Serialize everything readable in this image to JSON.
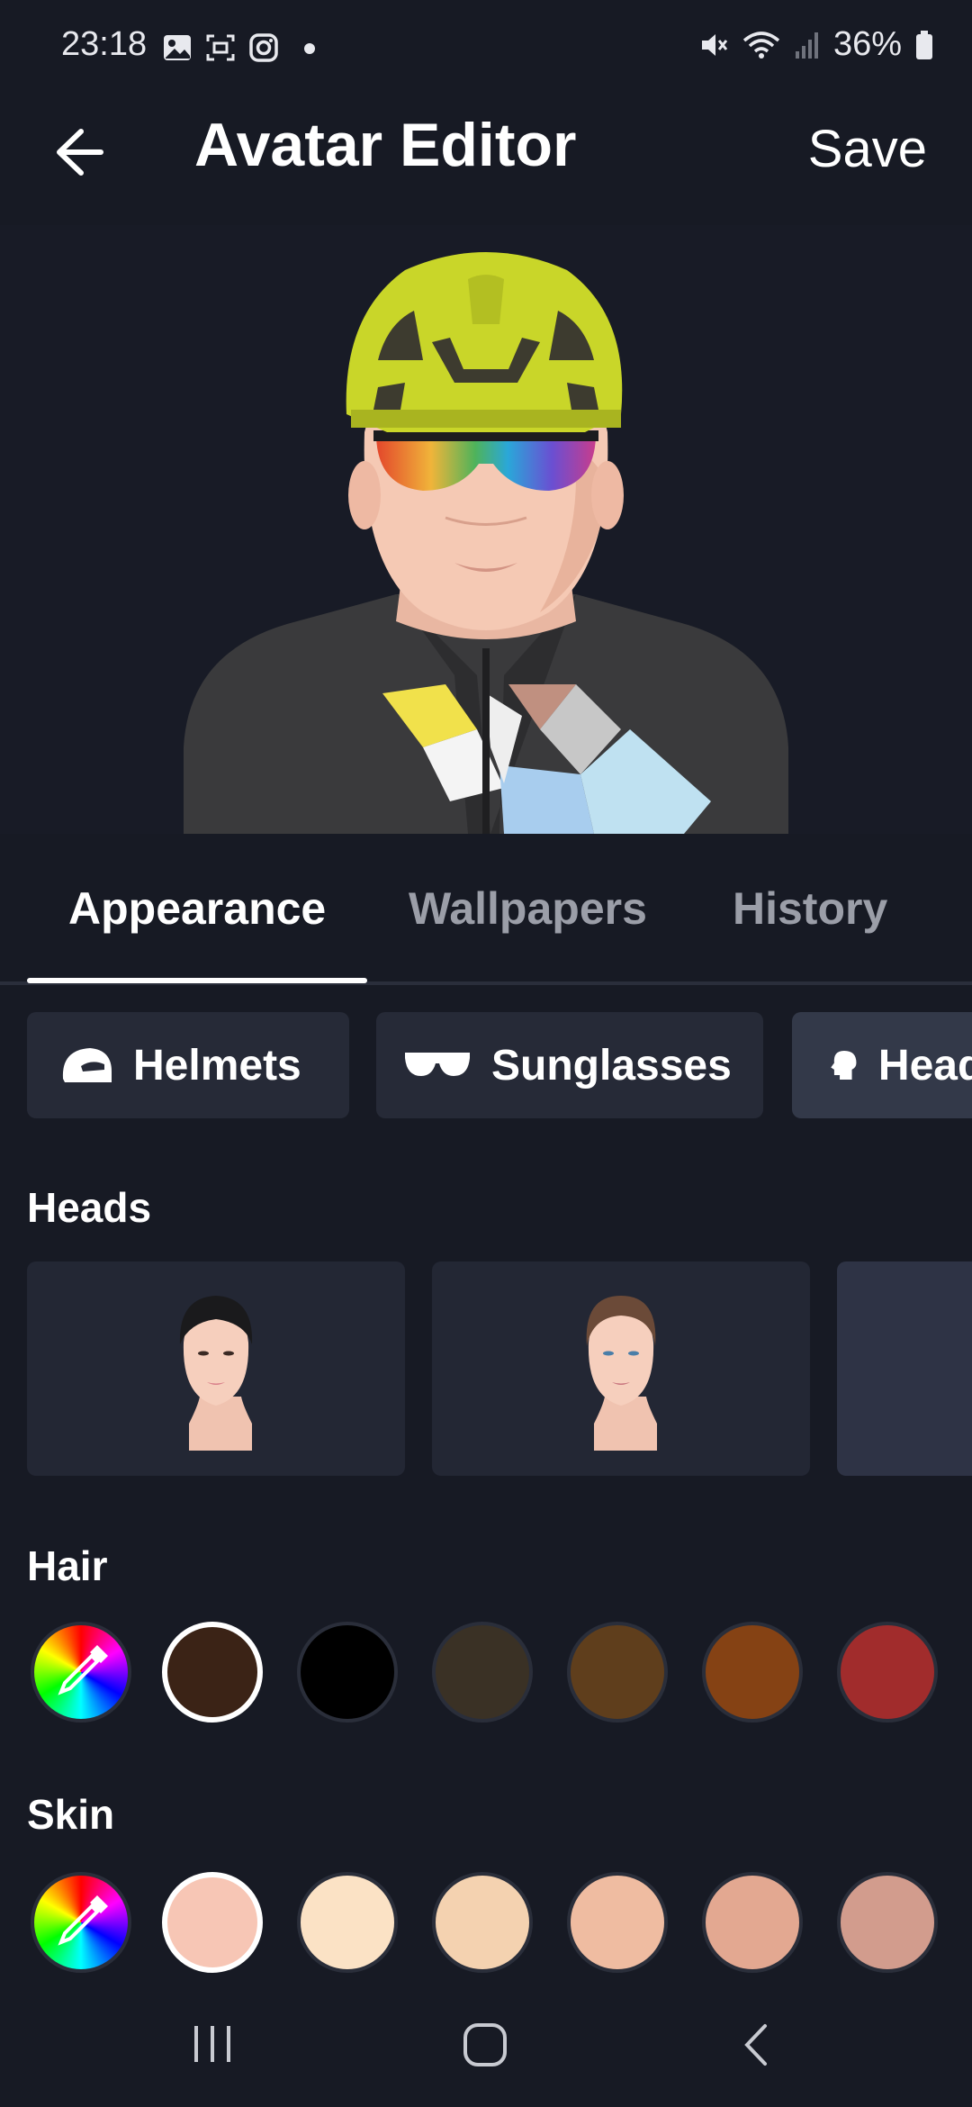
{
  "status": {
    "time": "23:18",
    "battery": "36%"
  },
  "appbar": {
    "title": "Avatar Editor",
    "save_label": "Save"
  },
  "tabs": [
    {
      "label": "Appearance",
      "active": true
    },
    {
      "label": "Wallpapers",
      "active": false
    },
    {
      "label": "History",
      "active": false
    }
  ],
  "categories": [
    {
      "label": "Helmets",
      "icon": "helmet-icon"
    },
    {
      "label": "Sunglasses",
      "icon": "sunglasses-icon"
    },
    {
      "label": "Heads",
      "icon": "head-icon"
    }
  ],
  "sections": {
    "heads": "Heads",
    "hair": "Hair",
    "skin": "Skin"
  },
  "hair_colors": [
    "#3b2316",
    "#000000",
    "#3a3125",
    "#5f3e1c",
    "#854214",
    "#a12c2c"
  ],
  "hair_selected": 0,
  "skin_colors": [
    "#f7c6b5",
    "#fbe2c5",
    "#f4d2b0",
    "#efbca1",
    "#e3a891",
    "#d29c8d"
  ],
  "skin_selected": 0,
  "colors": {
    "background": "#171a24",
    "card": "#232734",
    "chip": "#262a37",
    "helmet": "#c9d629"
  }
}
